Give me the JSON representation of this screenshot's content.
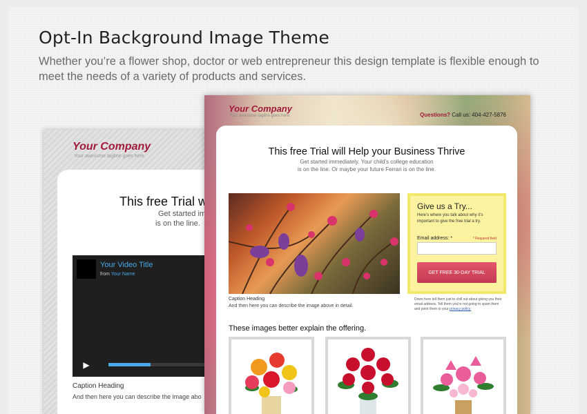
{
  "header": {
    "title": "Opt-In Background Image Theme",
    "subtitle": "Whether you’re a flower shop, doctor or web entrepreneur this design template is flexible enough to meet the needs of a variety of products and services."
  },
  "back_mockup": {
    "logo": "Your Company",
    "tagline": "Your awesome tagline goes here.",
    "title": "This free Trial w",
    "sub_line1": "Get started im",
    "sub_line2": "is on the line.",
    "video": {
      "title": "Your Video Title",
      "from_label": "from",
      "from_author": "Your Name",
      "play_icon": "play-icon",
      "progress_fraction": 0.32
    },
    "caption_heading": "Caption Heading",
    "caption_text": "And then here you can describe the image abo"
  },
  "front_mockup": {
    "logo": "Your Company",
    "tagline": "Your awesome tagline goes here.",
    "phone_label": "Questions?",
    "phone_text": "Call us: 404-427-5876",
    "title": "This free Trial will Help your Business Thrive",
    "sub_line1": "Get started immediately. Your child’s college education",
    "sub_line2": "is on the line. Or maybe your future Ferrari is on the line.",
    "caption_heading": "Caption Heading",
    "caption_text": "And then here you can describe the image above in detail.",
    "form": {
      "title": "Give us a Try...",
      "description": "Here’s where you talk about why it’s important to give the free trial a try.",
      "email_label": "Email address: *",
      "required_note": "* Required field",
      "email_value": "",
      "cta_label": "GET FREE 30-DAY TRIAL",
      "privacy_text": "Down here tell them just to chill out about giving you their email address. Tell them you're not going to spam them and point them to your",
      "privacy_link": "privacy policy."
    },
    "section_heading": "These images better explain the offering."
  },
  "colors": {
    "brand": "#a01a3a",
    "accent_blue": "#48a9e6",
    "cta": "#d64a61",
    "form_bg": "#fbf3a0"
  }
}
